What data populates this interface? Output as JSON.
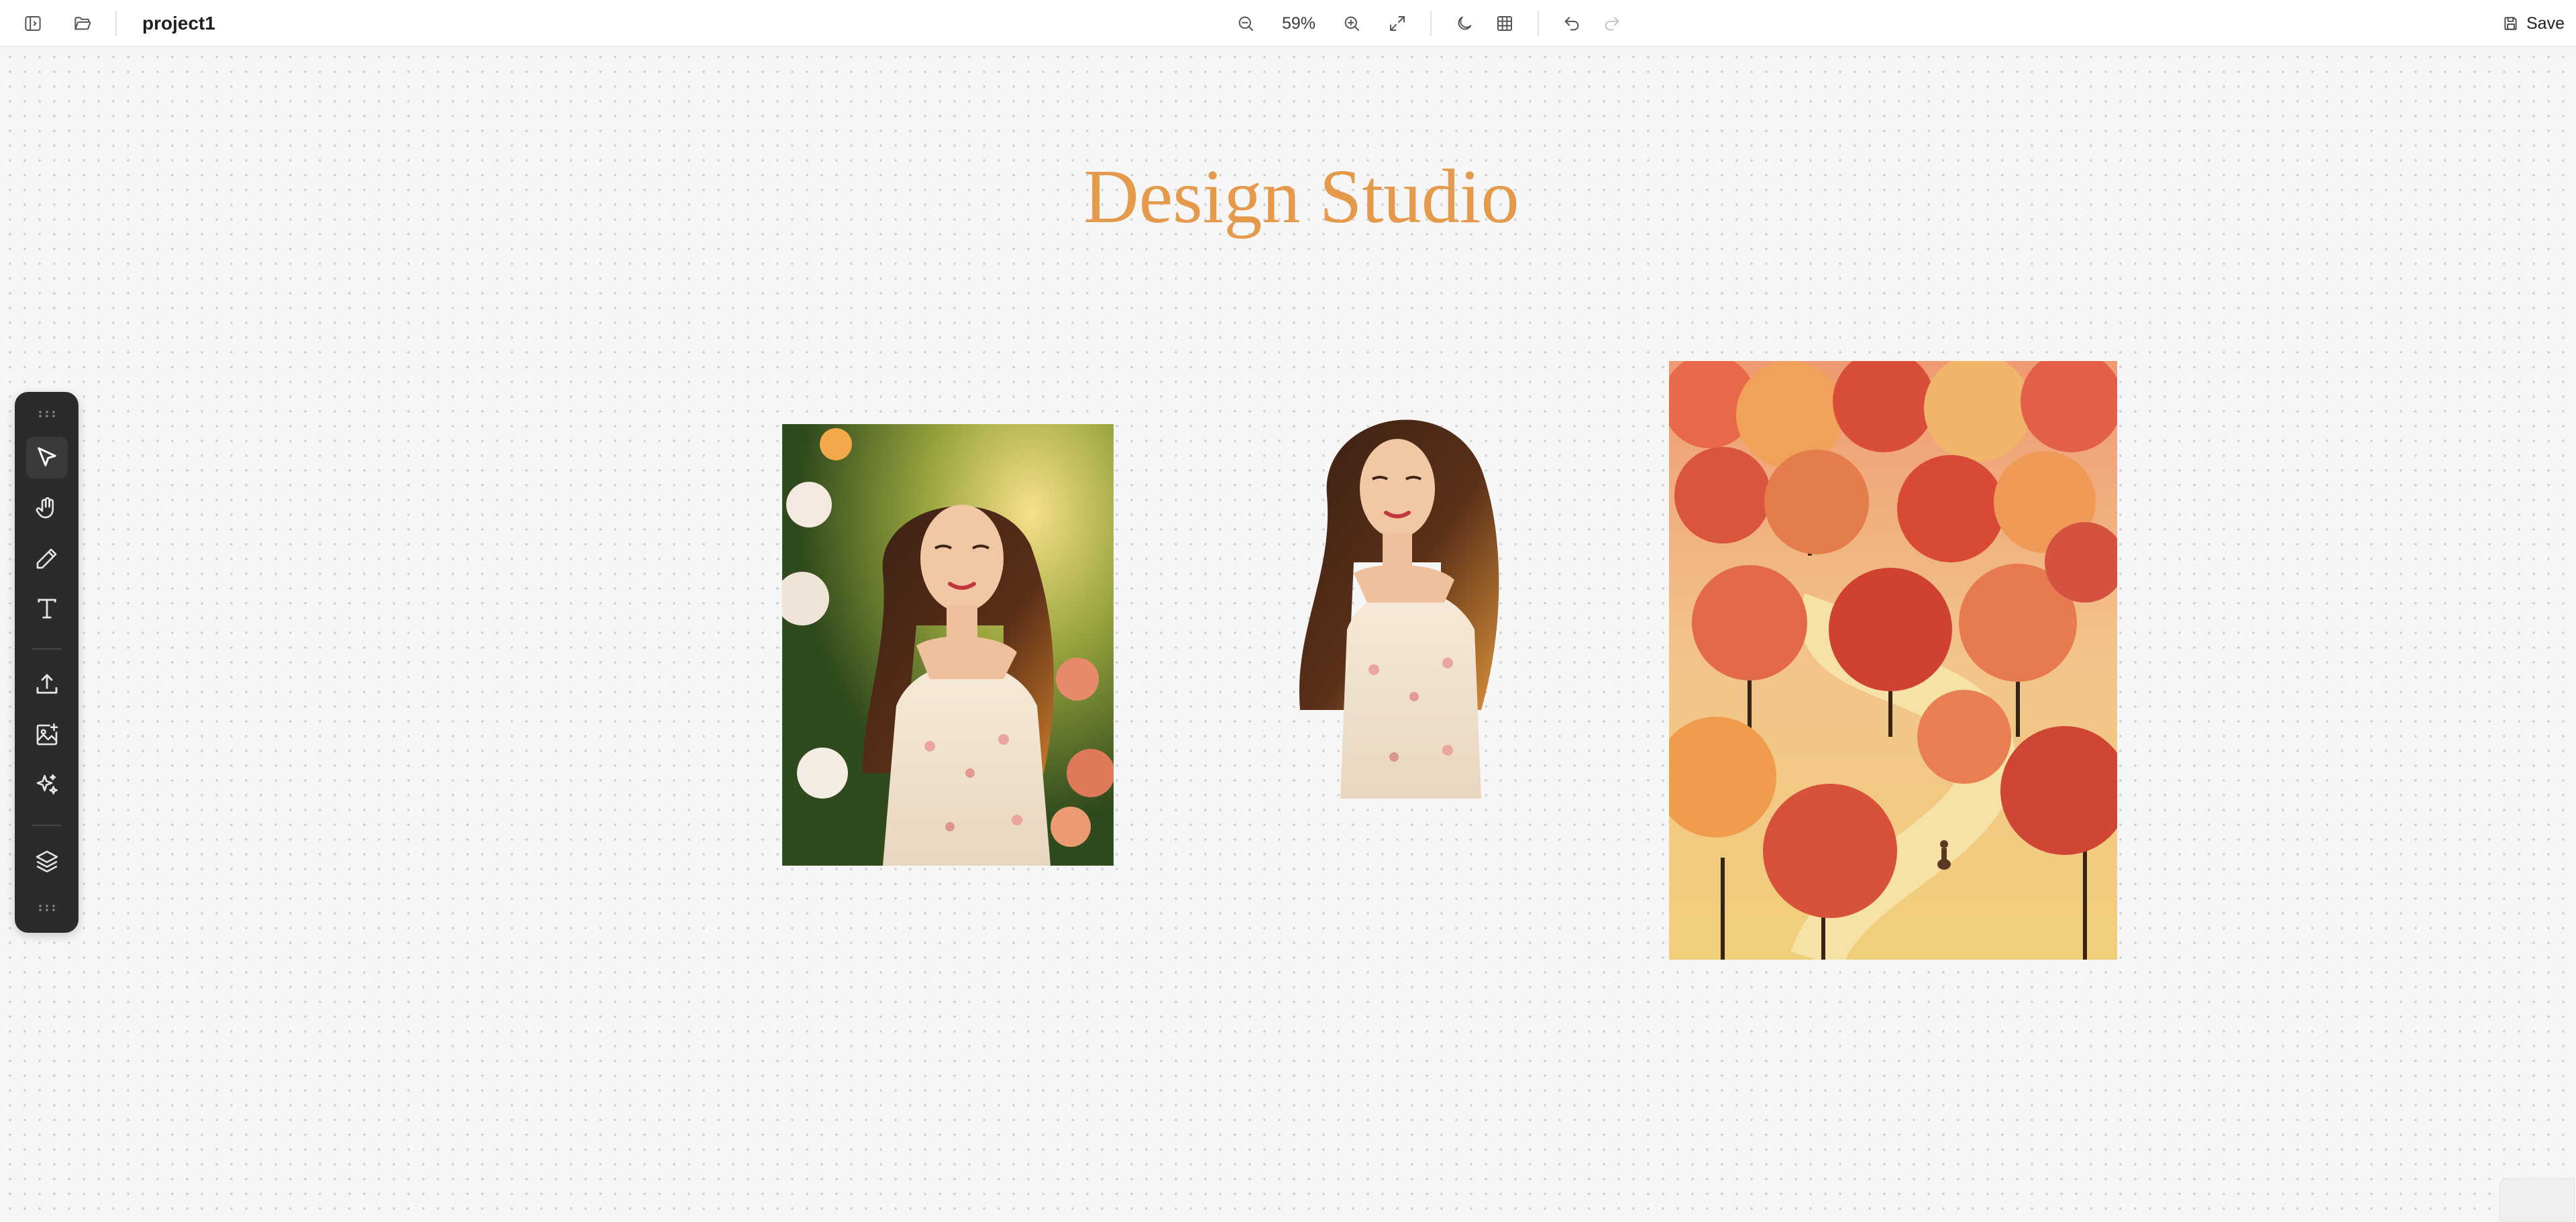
{
  "topbar": {
    "project_name": "project1",
    "zoom_level": "59%",
    "save_label": "Save",
    "icons": {
      "sidebar_toggle": "sidebar-panel-icon",
      "open_folder": "folder-open-icon",
      "zoom_out": "zoom-out-icon",
      "zoom_in": "zoom-in-icon",
      "fit": "expand-icon",
      "theme": "moon-icon",
      "grid": "grid-icon",
      "undo": "undo-icon",
      "redo": "redo-icon",
      "save": "floppy-disk-icon"
    }
  },
  "canvas": {
    "title": "Design Studio",
    "title_color": "#e49a4a",
    "artworks": [
      {
        "name": "portrait-photo-with-background",
        "description_icon": "image"
      },
      {
        "name": "portrait-photo-cutout",
        "description_icon": "image"
      },
      {
        "name": "autumn-forest-illustration",
        "description_icon": "image"
      }
    ]
  },
  "toolbar": {
    "tools": [
      {
        "name": "select",
        "icon": "cursor-arrow-icon",
        "active": true
      },
      {
        "name": "hand",
        "icon": "hand-icon",
        "active": false
      },
      {
        "name": "pencil",
        "icon": "pencil-icon",
        "active": false
      },
      {
        "name": "text",
        "icon": "text-icon",
        "active": false
      },
      {
        "name": "upload",
        "icon": "upload-icon",
        "active": false
      },
      {
        "name": "add-image",
        "icon": "image-plus-icon",
        "active": false
      },
      {
        "name": "ai-generate",
        "icon": "sparkles-icon",
        "active": false
      },
      {
        "name": "layers",
        "icon": "layers-icon",
        "active": false
      }
    ]
  },
  "colors": {
    "topbar_bg": "#ffffff",
    "canvas_bg": "#f6f6f6",
    "toolbar_bg": "#2b2b2b",
    "title": "#e49a4a"
  }
}
